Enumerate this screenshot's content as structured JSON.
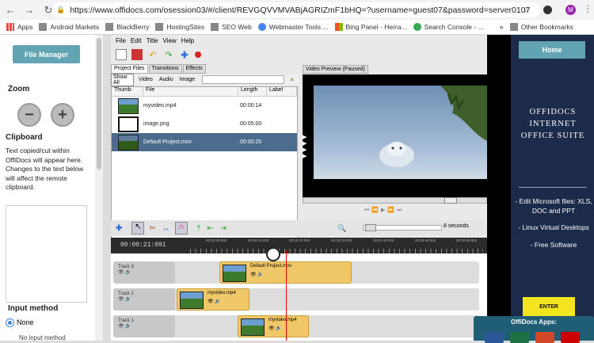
{
  "browser": {
    "nav": [
      "←",
      "→",
      "↻"
    ],
    "url": "https://www.offidocs.com/osession03/#/client/REVGQVVMVABjAGRIZmF1bHQ=?username=guest07&password=server0107",
    "avatar": "M",
    "bookmarks": [
      "Apps",
      "Android Markets",
      "BlackBerry",
      "HostingSites",
      "SEO Web",
      "Webmaster Tools ...",
      "Bing Panel - Herra...",
      "Search Console - ..."
    ],
    "other_bookmarks": "Other Bookmarks"
  },
  "left_panel": {
    "file_manager": "File Manager",
    "zoom": "Zoom",
    "zoom_minus": "−",
    "zoom_plus": "+",
    "clipboard": "Clipboard",
    "clipboard_text": "Text copied/cut within OffiDocs will appear here. Changes to the text below will affect the remote clipboard.",
    "input_method": "Input method",
    "none_option": "None",
    "no_input": "No input method"
  },
  "openshot": {
    "menu": [
      "File",
      "Edit",
      "Title",
      "View",
      "Help"
    ],
    "tabs": [
      "Project Files",
      "Transitions",
      "Effects"
    ],
    "filters": [
      "Show All",
      "Video",
      "Audio",
      "Image"
    ],
    "columns": [
      "Thumb",
      "File",
      "Length",
      "Label"
    ],
    "files": [
      {
        "name": "myvideo.mp4",
        "length": "00:00:14"
      },
      {
        "name": "image.png",
        "length": "00:05:00"
      },
      {
        "name": "Default Project.mov",
        "length": "00:00:25"
      }
    ],
    "preview_label": "Video Preview (Paused)",
    "zoom_label": "8 seconds",
    "timecode": "00:00:21:001",
    "ticks": [
      "00:00:08:000",
      "00:00:16:000",
      "00:00:24:000",
      "00:00:32:000",
      "00:00:40:000",
      "00:00:48:000",
      "00:00:56:000"
    ],
    "tracks": [
      {
        "name": "Track 3",
        "clip": "Default Project.mov"
      },
      {
        "name": "Track 2",
        "clip": "myvideo.mp4"
      },
      {
        "name": "Track 1",
        "clip": "myvideo.mp4"
      }
    ],
    "track_icons": "👁 🔊"
  },
  "right_panel": {
    "home": "Home",
    "title": "OFFIDOCS INTERNET OFFICE SUITE",
    "features": [
      "- Edit Microsoft files: XLS, DOC and PPT",
      "- Linux Virtual Desktops",
      "- Free Software"
    ],
    "enter": "ENTER",
    "apps_label": "OffiDocs Apps:"
  }
}
